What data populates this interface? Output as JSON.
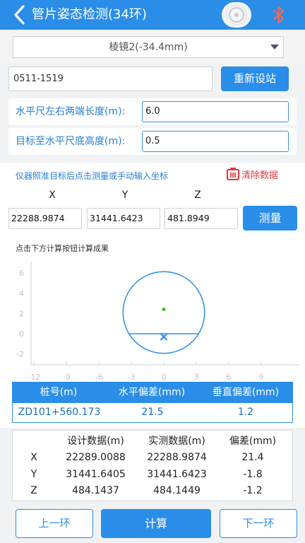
{
  "header": {
    "title": "管片姿态检测(34环)",
    "back_icon": "chevron-left-icon",
    "disc_icon": "disc-icon",
    "bluetooth_icon": "bluetooth-icon"
  },
  "prism_select": {
    "selected": "棱镜2(-34.4mm)"
  },
  "station": {
    "value": "0511-1519",
    "reset_label": "重新设站"
  },
  "ruler_length": {
    "label": "水平尺左右两端长度(m):",
    "value": "6.0"
  },
  "target_height": {
    "label": "目标至水平尺底高度(m):",
    "value": "0.5"
  },
  "measure": {
    "hint": "仪器照准目标后点击测量或手动输入坐标",
    "clear_label": "清除数据",
    "headers": [
      "X",
      "Y",
      "Z"
    ],
    "values": [
      "22288.9874",
      "31441.6423",
      "481.8949"
    ],
    "measure_label": "测量"
  },
  "graph": {
    "hint": "点击下方计算按钮计算成果",
    "y_ticks": [
      "6",
      "4",
      "2",
      "0",
      "-2"
    ],
    "x_ticks": [
      "-12",
      "-9",
      "-6",
      "-3",
      "0",
      "3",
      "6",
      "9"
    ]
  },
  "chart_data": {
    "type": "scatter",
    "xlim": [
      -12,
      12
    ],
    "ylim": [
      -2,
      6
    ],
    "x_ticks": [
      -12,
      -9,
      -6,
      -3,
      0,
      3,
      6,
      9
    ],
    "y_ticks": [
      6,
      4,
      2,
      0,
      -2
    ],
    "ring": {
      "center": [
        0,
        2.1
      ],
      "radius": 3.7
    },
    "design_center": [
      0,
      2.4
    ],
    "measured_point": [
      0,
      -0.3
    ],
    "grid": false
  },
  "result": {
    "headers": [
      "桩号(m)",
      "水平偏差(mm)",
      "垂直偏差(mm)"
    ],
    "values": [
      "ZD101+560.173",
      "21.5",
      "1.2"
    ]
  },
  "comparison": {
    "headers": [
      "设计数据(m)",
      "实测数据(m)",
      "偏差(mm)"
    ],
    "rows": [
      {
        "axis": "X",
        "design": "22289.0088",
        "measured": "22288.9874",
        "diff": "21.4"
      },
      {
        "axis": "Y",
        "design": "31441.6405",
        "measured": "31441.6423",
        "diff": "-1.8"
      },
      {
        "axis": "Z",
        "design": "484.1437",
        "measured": "484.1449",
        "diff": "-1.2"
      }
    ]
  },
  "footer": {
    "prev_label": "上一环",
    "calc_label": "计算",
    "next_label": "下一环"
  },
  "colors": {
    "accent": "#2a8ee8",
    "danger": "#e0393e",
    "point": "#44bb33"
  }
}
